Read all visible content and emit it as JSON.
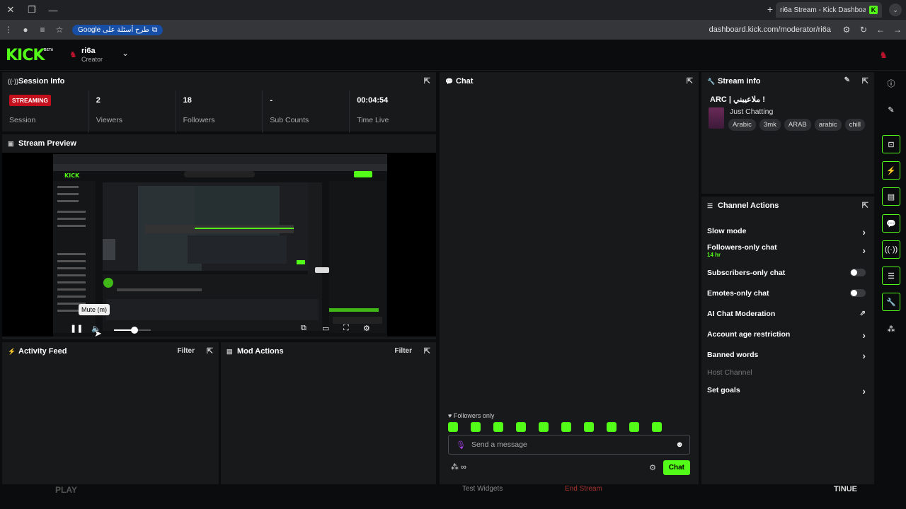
{
  "browser": {
    "tab_title": "ri6a Stream - Kick Dashboard",
    "tab_favicon": "K",
    "google_chip": "Google طرح أسئلة على",
    "url": "dashboard.kick.com/moderator/ri6a"
  },
  "header": {
    "logo": "KICK",
    "logo_badge": "BETA",
    "channel_name": "ri6a",
    "channel_role": "Creator"
  },
  "session": {
    "title": "Session Info",
    "badge": "STREAMING",
    "badge_label": "Session",
    "stats": [
      {
        "value": "2",
        "label": "Viewers"
      },
      {
        "value": "18",
        "label": "Followers"
      },
      {
        "value": "-",
        "label": "Sub Counts"
      },
      {
        "value": "00:04:54",
        "label": "Time Live"
      }
    ]
  },
  "preview": {
    "title": "Stream Preview",
    "tooltip": "Mute (m)",
    "volume_level": 0.55
  },
  "activity": {
    "title": "Activity Feed",
    "filter": "Filter"
  },
  "mod_actions": {
    "title": "Mod Actions",
    "filter": "Filter"
  },
  "chat": {
    "title": "Chat",
    "followers_only": "Followers only",
    "placeholder": "Send a message",
    "send_label": "Chat",
    "emote_count": 10
  },
  "stream_info": {
    "title": "Stream info",
    "stream_title": "ARC | ملاعيبني !",
    "category": "Just Chatting",
    "tags": [
      "Arabic",
      "3mk",
      "ARAB",
      "arabic",
      "chill"
    ]
  },
  "channel_actions": {
    "title": "Channel Actions",
    "items": [
      {
        "label": "Slow mode",
        "kind": "chevron"
      },
      {
        "label": "Followers-only chat",
        "sub": "14 hr",
        "kind": "chevron"
      },
      {
        "label": "Subscribers-only chat",
        "kind": "toggle"
      },
      {
        "label": "Emotes-only chat",
        "kind": "toggle"
      },
      {
        "label": "AI Chat Moderation",
        "kind": "external"
      },
      {
        "label": "Account age restriction",
        "kind": "chevron"
      },
      {
        "label": "Banned words",
        "kind": "chevron"
      },
      {
        "label": "Host Channel",
        "kind": "disabled"
      },
      {
        "label": "Set goals",
        "kind": "chevron"
      }
    ]
  },
  "bottom": {
    "left_text": "PLAY",
    "test_widgets": "Test Widgets",
    "end_stream": "End Stream",
    "continue": "TINUE"
  }
}
